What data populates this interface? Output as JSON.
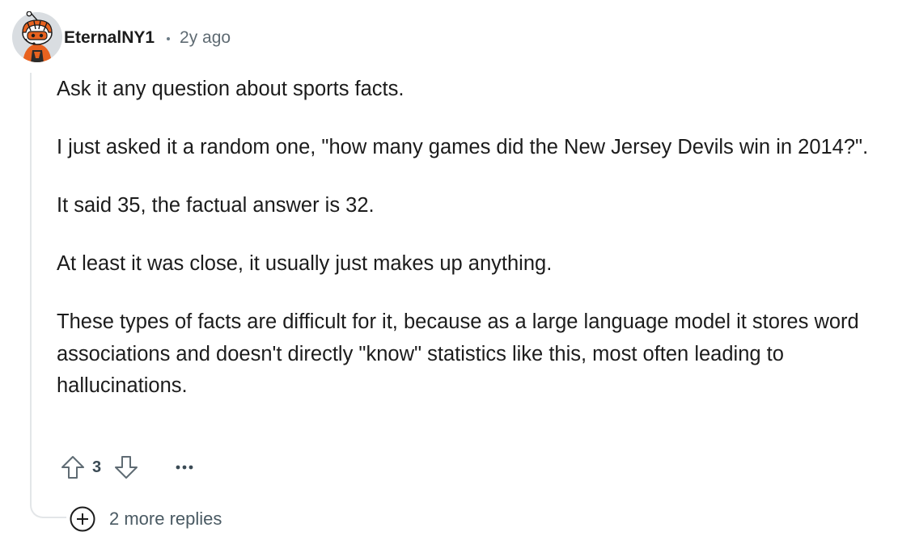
{
  "comment": {
    "author": "EternalNY1",
    "separator": "•",
    "time": "2y ago",
    "paragraphs": [
      "Ask it any question about sports facts.",
      "I just asked it a random one, \"how many games did the New Jersey Devils win in 2014?\".",
      "It said 35, the factual answer is 32.",
      "At least it was close, it usually just makes up anything.",
      "These types of facts are difficult for it, because as a large language model it stores word associations and doesn't directly \"know\" statistics like this, most often leading to hallucinations."
    ],
    "score": "3",
    "more_replies_label": "2 more replies"
  },
  "icons": {
    "avatar": "snoo-avatar-icon",
    "upvote": "upvote-arrow-icon",
    "downvote": "downvote-arrow-icon",
    "more": "ellipsis-icon",
    "expand": "plus-circle-icon"
  },
  "colors": {
    "text": "#1c1c1c",
    "meta": "#5f6b73",
    "thread_line": "#e3e6e8",
    "icon": "#5f6b73"
  }
}
